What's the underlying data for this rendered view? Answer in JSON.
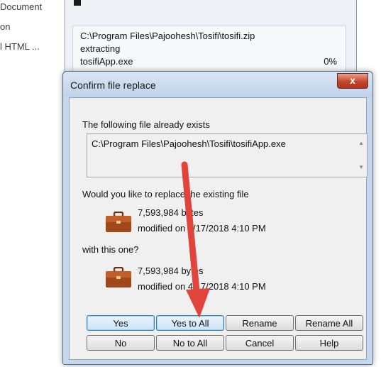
{
  "background": {
    "sidebar_items": [
      "Document",
      "on",
      "l HTML ..."
    ],
    "progress_window": {
      "path": "C:\\Program Files\\Pajoohesh\\Tosifi\\tosifi.zip",
      "status": "extracting",
      "file": "tosifiApp.exe",
      "percent": "0%"
    }
  },
  "dialog": {
    "title": "Confirm file replace",
    "close_label": "x",
    "message": "The following file already exists",
    "path": "C:\\Program Files\\Pajoohesh\\Tosifi\\tosifiApp.exe",
    "question": "Would you like to replace the existing file",
    "existing_file": {
      "size": "7,593,984 bytes",
      "modified": "modified on 4/17/2018 4:10 PM"
    },
    "with_label": "with this one?",
    "new_file": {
      "size": "7,593,984 bytes",
      "modified": "modified on 4/17/2018 4:10 PM"
    },
    "buttons": {
      "yes": "Yes",
      "yes_to_all": "Yes to All",
      "rename": "Rename",
      "rename_all": "Rename All",
      "no": "No",
      "no_to_all": "No to All",
      "cancel": "Cancel",
      "help": "Help"
    }
  },
  "annotation": {
    "arrow_color": "#e0443a"
  }
}
